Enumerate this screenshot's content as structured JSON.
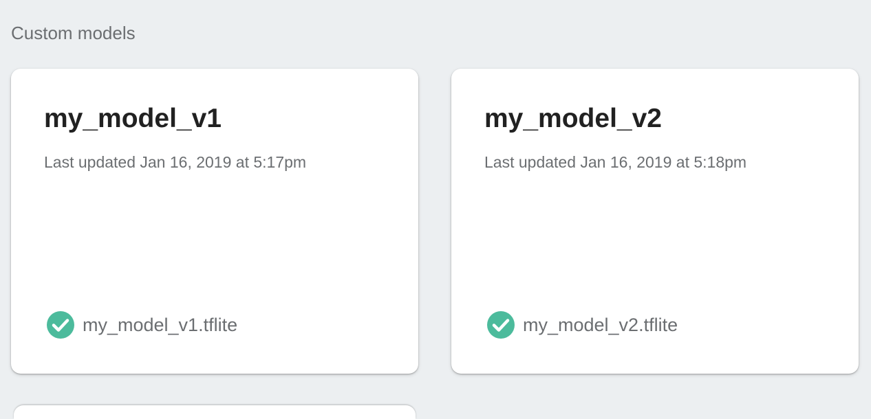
{
  "section": {
    "heading": "Custom models"
  },
  "models": [
    {
      "name": "my_model_v1",
      "updated": "Last updated Jan 16, 2019 at 5:17pm",
      "file": "my_model_v1.tflite",
      "status_icon": "check-circle-icon"
    },
    {
      "name": "my_model_v2",
      "updated": "Last updated Jan 16, 2019 at 5:18pm",
      "file": "my_model_v2.tflite",
      "status_icon": "check-circle-icon"
    }
  ],
  "colors": {
    "background": "#eceff1",
    "card": "#ffffff",
    "success": "#4cbb9c",
    "title_text": "#212121",
    "secondary_text": "#6b6e71"
  }
}
